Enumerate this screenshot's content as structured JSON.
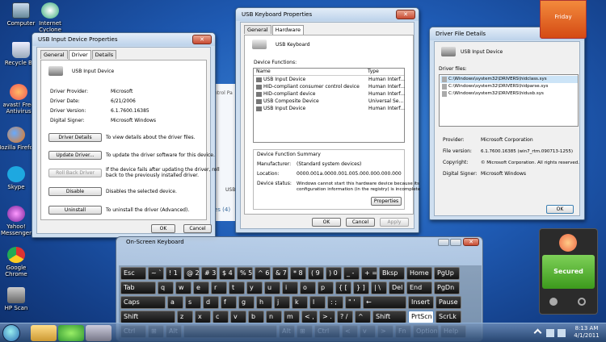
{
  "desktop_icons": [
    {
      "label": "Computer",
      "icon": "computer-icon"
    },
    {
      "label": "Internet Cyclone",
      "icon": "cyclone-icon"
    },
    {
      "label": "Recycle Bin",
      "icon": "recycle-bin-icon"
    },
    {
      "label": "avast! Free Antivirus",
      "icon": "avast-icon"
    },
    {
      "label": "Mozilla Firefox",
      "icon": "firefox-icon"
    },
    {
      "label": "Skype",
      "icon": "skype-icon"
    },
    {
      "label": "Yahoo! Messenger",
      "icon": "yahoo-icon"
    },
    {
      "label": "Google Chrome",
      "icon": "chrome-icon"
    },
    {
      "label": "HP Scan",
      "icon": "hp-scan-icon"
    }
  ],
  "props_window": {
    "title": "USB Input Device Properties",
    "tabs": [
      "General",
      "Driver",
      "Details"
    ],
    "device_name": "USB Input Device",
    "rows": [
      {
        "label": "Driver Provider:",
        "value": "Microsoft"
      },
      {
        "label": "Driver Date:",
        "value": "6/21/2006"
      },
      {
        "label": "Driver Version:",
        "value": "6.1.7600.16385"
      },
      {
        "label": "Digital Signer:",
        "value": "Microsoft Windows"
      }
    ],
    "actions": [
      {
        "button": "Driver Details",
        "desc1": "To view details about the driver files.",
        "desc2": ""
      },
      {
        "button": "Update Driver...",
        "desc1": "To update the driver software for this device.",
        "desc2": ""
      },
      {
        "button": "Roll Back Driver",
        "desc1": "If the device fails after updating the driver, roll",
        "desc2": "back to the previously installed driver."
      },
      {
        "button": "Disable",
        "desc1": "Disables the selected device.",
        "desc2": ""
      },
      {
        "button": "Uninstall",
        "desc1": "To uninstall the driver (Advanced).",
        "desc2": ""
      }
    ],
    "ok": "OK",
    "cancel": "Cancel"
  },
  "kb_window": {
    "title": "USB Keyboard Properties",
    "tabs": [
      "General",
      "Hardware"
    ],
    "device_name": "USB Keyboard",
    "functions_label": "Device Functions:",
    "col_name": "Name",
    "col_type": "Type",
    "devices": [
      {
        "name": "USB Input Device",
        "type": "Human Interf..."
      },
      {
        "name": "HID-compliant consumer control device",
        "type": "Human Interf..."
      },
      {
        "name": "HID-compliant device",
        "type": "Human Interf..."
      },
      {
        "name": "USB Composite Device",
        "type": "Universal Se..."
      },
      {
        "name": "USB Input Device",
        "type": "Human Interf..."
      }
    ],
    "summary_label": "Device Function Summary",
    "summary": [
      {
        "label": "Manufacturer:",
        "value": "(Standard system devices)"
      },
      {
        "label": "Location:",
        "value": "0000.001a.0000.001.005.000.000.000.000"
      },
      {
        "label": "Device status:",
        "value": "Windows cannot start this hardware device because its"
      }
    ],
    "status_line2": "configuration information (in the registry) is incomplete",
    "properties": "Properties",
    "ok": "OK",
    "cancel": "Cancel",
    "apply": "Apply"
  },
  "file_window": {
    "title": "Driver File Details",
    "device_name": "USB Input Device",
    "files_label": "Driver files:",
    "files": [
      "C:\\Windows\\system32\\DRIVERS\\hidclass.sys",
      "C:\\Windows\\system32\\DRIVERS\\hidparse.sys",
      "C:\\Windows\\system32\\DRIVERS\\hidusb.sys"
    ],
    "rows": [
      {
        "label": "Provider:",
        "value": "Microsoft Corporation"
      },
      {
        "label": "File version:",
        "value": "6.1.7600.16385 (win7_rtm.090713-1255)"
      },
      {
        "label": "Copyright:",
        "value": "© Microsoft Corporation. All rights reserved."
      },
      {
        "label": "Digital Signer:",
        "value": "Microsoft Windows"
      }
    ],
    "ok": "OK"
  },
  "behind": {
    "frag1": "ntrol Pa",
    "frag2": "USB",
    "frag3": "es (4)"
  },
  "osk": {
    "title": "On-Screen Keyboard",
    "rows": [
      [
        {
          "l": "Esc",
          "w": 34
        },
        {
          "l": "~ `",
          "w": 22
        },
        {
          "l": "! 1",
          "w": 22
        },
        {
          "l": "@ 2",
          "w": 22
        },
        {
          "l": "# 3",
          "w": 22
        },
        {
          "l": "$ 4",
          "w": 22
        },
        {
          "l": "% 5",
          "w": 22
        },
        {
          "l": "^ 6",
          "w": 22
        },
        {
          "l": "& 7",
          "w": 22
        },
        {
          "l": "* 8",
          "w": 22
        },
        {
          "l": "( 9",
          "w": 22
        },
        {
          "l": ") 0",
          "w": 22
        },
        {
          "l": "_ -",
          "w": 22
        },
        {
          "l": "+ =",
          "w": 22
        },
        {
          "l": "Bksp",
          "w": 34
        },
        {
          "l": "Home",
          "w": 34
        },
        {
          "l": "PgUp",
          "w": 34
        }
      ],
      [
        {
          "l": "Tab",
          "w": 46
        },
        {
          "l": "q",
          "w": 22
        },
        {
          "l": "w",
          "w": 22
        },
        {
          "l": "e",
          "w": 22
        },
        {
          "l": "r",
          "w": 22
        },
        {
          "l": "t",
          "w": 22
        },
        {
          "l": "y",
          "w": 22
        },
        {
          "l": "u",
          "w": 22
        },
        {
          "l": "i",
          "w": 22
        },
        {
          "l": "o",
          "w": 22
        },
        {
          "l": "p",
          "w": 22
        },
        {
          "l": "{ [",
          "w": 22
        },
        {
          "l": "} ]",
          "w": 22
        },
        {
          "l": "| \\",
          "w": 22
        },
        {
          "l": "Del",
          "w": 22
        },
        {
          "l": "End",
          "w": 34
        },
        {
          "l": "PgDn",
          "w": 34
        }
      ],
      [
        {
          "l": "Caps",
          "w": 58
        },
        {
          "l": "a",
          "w": 22
        },
        {
          "l": "s",
          "w": 22
        },
        {
          "l": "d",
          "w": 22
        },
        {
          "l": "f",
          "w": 22
        },
        {
          "l": "g",
          "w": 22
        },
        {
          "l": "h",
          "w": 22
        },
        {
          "l": "j",
          "w": 22
        },
        {
          "l": "k",
          "w": 22
        },
        {
          "l": "l",
          "w": 22
        },
        {
          "l": ": ;",
          "w": 22
        },
        {
          "l": "\" '",
          "w": 22
        },
        {
          "l": "←",
          "w": 56
        },
        {
          "l": "Insert",
          "w": 34
        },
        {
          "l": "Pause",
          "w": 34
        }
      ],
      [
        {
          "l": "Shift",
          "w": 70
        },
        {
          "l": "z",
          "w": 22
        },
        {
          "l": "x",
          "w": 22
        },
        {
          "l": "c",
          "w": 22
        },
        {
          "l": "v",
          "w": 22
        },
        {
          "l": "b",
          "w": 22
        },
        {
          "l": "n",
          "w": 22
        },
        {
          "l": "m",
          "w": 22
        },
        {
          "l": "< ,",
          "w": 22
        },
        {
          "l": "> .",
          "w": 22
        },
        {
          "l": "? /",
          "w": 22
        },
        {
          "l": "^",
          "w": 22
        },
        {
          "l": "Shift",
          "w": 44
        },
        {
          "l": "PrtScn",
          "w": 34,
          "hl": true
        },
        {
          "l": "ScrLk",
          "w": 34
        }
      ],
      [
        {
          "l": "Ctrl",
          "w": 34
        },
        {
          "l": "⊞",
          "w": 22
        },
        {
          "l": "Alt",
          "w": 22
        },
        {
          "l": "",
          "w": 118
        },
        {
          "l": "Alt",
          "w": 22
        },
        {
          "l": "⊞",
          "w": 22
        },
        {
          "l": "Ctrl",
          "w": 34
        },
        {
          "l": "<",
          "w": 22
        },
        {
          "l": "v",
          "w": 22
        },
        {
          "l": ">",
          "w": 22
        },
        {
          "l": "Fn",
          "w": 22
        },
        {
          "l": "Options",
          "w": 34
        },
        {
          "l": "Help",
          "w": 34
        }
      ]
    ]
  },
  "calendar_tile": {
    "day": "Friday"
  },
  "avast_gadget": {
    "status": "Secured"
  },
  "clock": {
    "time": "8:13 AM",
    "date": "4/1/2011"
  }
}
